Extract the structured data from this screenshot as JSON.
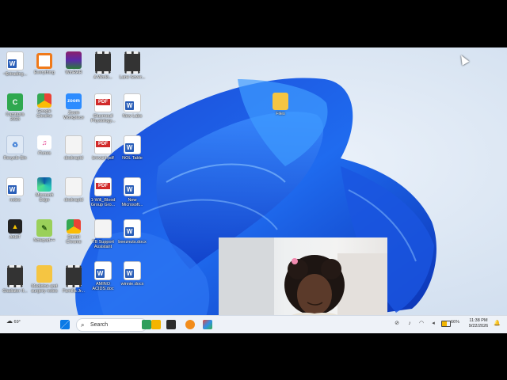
{
  "desktop": {
    "icons": [
      {
        "label": "~$xtrading...",
        "type": "word"
      },
      {
        "label": "Everything",
        "type": "everything"
      },
      {
        "label": "WinRAR",
        "type": "winrar"
      },
      {
        "label": "A Worki...",
        "type": "film"
      },
      {
        "label": "Lane Sover...",
        "type": "film"
      },
      {
        "label": "Camtasia 2023",
        "type": "camtasia"
      },
      {
        "label": "Google Chrome",
        "type": "chrome"
      },
      {
        "label": "Zoom Workplace",
        "type": "zoom"
      },
      {
        "label": "Glucrnouil Physiology...",
        "type": "pdf"
      },
      {
        "label": "New Labs",
        "type": "word"
      },
      {
        "label": "Recycle Bin",
        "type": "recycle"
      },
      {
        "label": "iTunes",
        "type": "itunes"
      },
      {
        "label": "deskrapid",
        "type": "blank"
      },
      {
        "label": "brevant.pdf",
        "type": "pdf"
      },
      {
        "label": "NOL Table",
        "type": "word"
      },
      {
        "label": "notes",
        "type": "word"
      },
      {
        "label": "Microsoft Edge",
        "type": "edge"
      },
      {
        "label": "deskrapid",
        "type": "blank"
      },
      {
        "label": "1-Will_Blood Group Gro...",
        "type": "pdf"
      },
      {
        "label": "New Microsoft...",
        "type": "word"
      },
      {
        "label": "AnkiT",
        "type": "anki"
      },
      {
        "label": "Notepad++",
        "type": "notepad"
      },
      {
        "label": "Daniel Chrome",
        "type": "chrome"
      },
      {
        "label": "TB Support Assistant",
        "type": "blank"
      },
      {
        "label": "beeznuts.docx",
        "type": "word"
      },
      {
        "label": "Gladiator II...",
        "type": "film"
      },
      {
        "label": "Medicine and surgery notes",
        "type": "folder"
      },
      {
        "label": "Familia Jr...",
        "type": "film"
      },
      {
        "label": "AMINO ACIDS.doc",
        "type": "word"
      },
      {
        "label": "winnie.docx",
        "type": "word"
      },
      {
        "label": "Files",
        "type": "folder"
      }
    ]
  },
  "taskbar": {
    "weather_temp": "69°",
    "search_placeholder": "Search",
    "battery": "66%",
    "time": "11:38 PM",
    "date": "9/22/2026"
  }
}
